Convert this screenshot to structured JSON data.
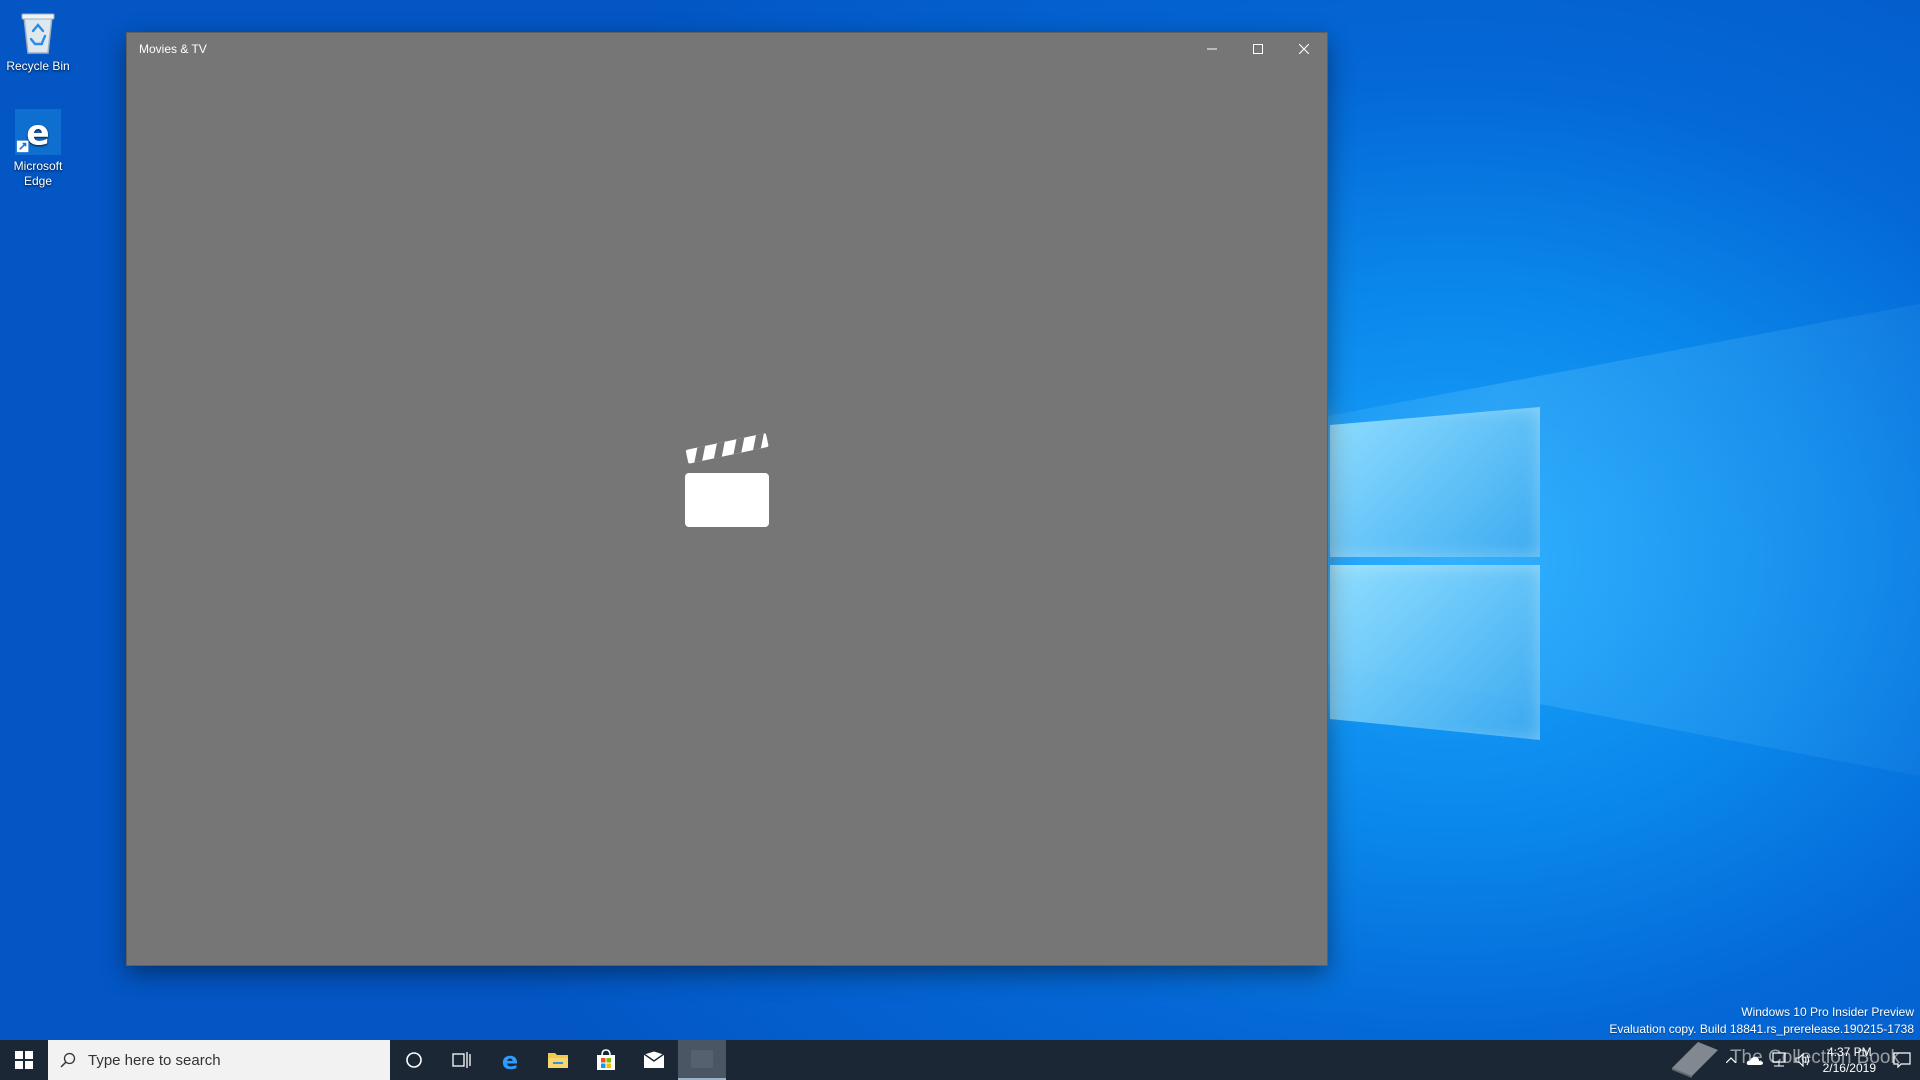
{
  "desktop": {
    "icons": [
      {
        "label": "Recycle Bin"
      },
      {
        "label": "Microsoft Edge"
      }
    ],
    "watermark": {
      "line1": "Windows 10 Pro Insider Preview",
      "line2": "Evaluation copy. Build 18841.rs_prerelease.190215-1738"
    },
    "brand": "The Collection Book"
  },
  "window": {
    "title": "Movies & TV",
    "background": "#767676",
    "splash_icon": "clapperboard-icon"
  },
  "taskbar": {
    "search_placeholder": "Type here to search",
    "pinned": [
      "cortana-icon",
      "task-view-icon",
      "edge-icon",
      "file-explorer-icon",
      "store-icon",
      "mail-icon",
      "movies-tv-icon"
    ],
    "clock": {
      "time": "4:37 PM",
      "date": "2/16/2019"
    }
  }
}
